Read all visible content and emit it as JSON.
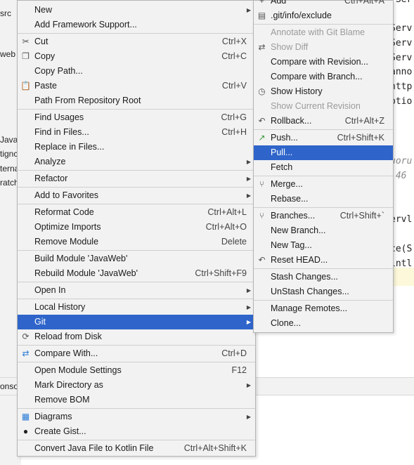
{
  "background": {
    "project_tree": [
      {
        "text": "src"
      },
      {
        "text": "web"
      },
      {
        "text": "Java"
      },
      {
        "text": "tignc"
      },
      {
        "text": "terna"
      },
      {
        "text": "ratch"
      }
    ],
    "editor_lines": [
      {
        "text": ".Ser",
        "italic": false
      },
      {
        "text": "Serv",
        "italic": false
      },
      {
        "text": "Serv",
        "italic": false
      },
      {
        "text": "Serv",
        "italic": false
      },
      {
        "text": "anno",
        "italic": false
      },
      {
        "text": "http",
        "italic": false
      },
      {
        "text": "ptio",
        "italic": false
      },
      {
        "text": "uoru",
        "italic": true
      },
      {
        "text": ":46",
        "italic": true
      },
      {
        "text": "ervl",
        "italic": false
      },
      {
        "text": "ce(S",
        "italic": false
      },
      {
        "text": "intl",
        "italic": false
      }
    ],
    "bottom_tab": "onso"
  },
  "main_menu": {
    "items": [
      {
        "type": "item",
        "label": "New",
        "icon": "",
        "shortcut": "",
        "submenu": true,
        "disabled": false,
        "selected": false
      },
      {
        "type": "item",
        "label": "Add Framework Support...",
        "icon": "",
        "shortcut": "",
        "submenu": false,
        "disabled": false,
        "selected": false
      },
      {
        "type": "sep"
      },
      {
        "type": "item",
        "label": "Cut",
        "icon": "scissors-icon",
        "shortcut": "Ctrl+X",
        "submenu": false,
        "disabled": false,
        "selected": false
      },
      {
        "type": "item",
        "label": "Copy",
        "icon": "copy-icon",
        "shortcut": "Ctrl+C",
        "submenu": false,
        "disabled": false,
        "selected": false
      },
      {
        "type": "item",
        "label": "Copy Path...",
        "icon": "",
        "shortcut": "",
        "submenu": false,
        "disabled": false,
        "selected": false
      },
      {
        "type": "item",
        "label": "Paste",
        "icon": "paste-icon",
        "shortcut": "Ctrl+V",
        "submenu": false,
        "disabled": false,
        "selected": false
      },
      {
        "type": "item",
        "label": "Path From Repository Root",
        "icon": "",
        "shortcut": "",
        "submenu": false,
        "disabled": false,
        "selected": false
      },
      {
        "type": "sep"
      },
      {
        "type": "item",
        "label": "Find Usages",
        "icon": "",
        "shortcut": "Ctrl+G",
        "submenu": false,
        "disabled": false,
        "selected": false
      },
      {
        "type": "item",
        "label": "Find in Files...",
        "icon": "",
        "shortcut": "Ctrl+H",
        "submenu": false,
        "disabled": false,
        "selected": false
      },
      {
        "type": "item",
        "label": "Replace in Files...",
        "icon": "",
        "shortcut": "",
        "submenu": false,
        "disabled": false,
        "selected": false
      },
      {
        "type": "item",
        "label": "Analyze",
        "icon": "",
        "shortcut": "",
        "submenu": true,
        "disabled": false,
        "selected": false
      },
      {
        "type": "sep"
      },
      {
        "type": "item",
        "label": "Refactor",
        "icon": "",
        "shortcut": "",
        "submenu": true,
        "disabled": false,
        "selected": false
      },
      {
        "type": "sep"
      },
      {
        "type": "item",
        "label": "Add to Favorites",
        "icon": "",
        "shortcut": "",
        "submenu": true,
        "disabled": false,
        "selected": false
      },
      {
        "type": "sep"
      },
      {
        "type": "item",
        "label": "Reformat Code",
        "icon": "",
        "shortcut": "Ctrl+Alt+L",
        "submenu": false,
        "disabled": false,
        "selected": false
      },
      {
        "type": "item",
        "label": "Optimize Imports",
        "icon": "",
        "shortcut": "Ctrl+Alt+O",
        "submenu": false,
        "disabled": false,
        "selected": false
      },
      {
        "type": "item",
        "label": "Remove Module",
        "icon": "",
        "shortcut": "Delete",
        "submenu": false,
        "disabled": false,
        "selected": false
      },
      {
        "type": "sep"
      },
      {
        "type": "item",
        "label": "Build Module 'JavaWeb'",
        "icon": "",
        "shortcut": "",
        "submenu": false,
        "disabled": false,
        "selected": false
      },
      {
        "type": "item",
        "label": "Rebuild Module 'JavaWeb'",
        "icon": "",
        "shortcut": "Ctrl+Shift+F9",
        "submenu": false,
        "disabled": false,
        "selected": false
      },
      {
        "type": "sep"
      },
      {
        "type": "item",
        "label": "Open In",
        "icon": "",
        "shortcut": "",
        "submenu": true,
        "disabled": false,
        "selected": false
      },
      {
        "type": "sep"
      },
      {
        "type": "item",
        "label": "Local History",
        "icon": "",
        "shortcut": "",
        "submenu": true,
        "disabled": false,
        "selected": false
      },
      {
        "type": "item",
        "label": "Git",
        "icon": "",
        "shortcut": "",
        "submenu": true,
        "disabled": false,
        "selected": true
      },
      {
        "type": "item",
        "label": "Reload from Disk",
        "icon": "reload-icon",
        "shortcut": "",
        "submenu": false,
        "disabled": false,
        "selected": false
      },
      {
        "type": "sep"
      },
      {
        "type": "item",
        "label": "Compare With...",
        "icon": "compare-icon",
        "shortcut": "Ctrl+D",
        "submenu": false,
        "disabled": false,
        "selected": false
      },
      {
        "type": "sep"
      },
      {
        "type": "item",
        "label": "Open Module Settings",
        "icon": "",
        "shortcut": "F12",
        "submenu": false,
        "disabled": false,
        "selected": false
      },
      {
        "type": "item",
        "label": "Mark Directory as",
        "icon": "",
        "shortcut": "",
        "submenu": true,
        "disabled": false,
        "selected": false
      },
      {
        "type": "item",
        "label": "Remove BOM",
        "icon": "",
        "shortcut": "",
        "submenu": false,
        "disabled": false,
        "selected": false
      },
      {
        "type": "sep"
      },
      {
        "type": "item",
        "label": "Diagrams",
        "icon": "diagram-icon",
        "shortcut": "",
        "submenu": true,
        "disabled": false,
        "selected": false
      },
      {
        "type": "item",
        "label": "Create Gist...",
        "icon": "github-icon",
        "shortcut": "",
        "submenu": false,
        "disabled": false,
        "selected": false
      },
      {
        "type": "sep"
      },
      {
        "type": "item",
        "label": "Convert Java File to Kotlin File",
        "icon": "",
        "shortcut": "Ctrl+Alt+Shift+K",
        "submenu": false,
        "disabled": false,
        "selected": false
      }
    ]
  },
  "git_submenu": {
    "items": [
      {
        "type": "item",
        "label": "Add",
        "icon": "add-icon",
        "shortcut": "Ctrl+Alt+A",
        "disabled": false,
        "selected": false
      },
      {
        "type": "item",
        "label": ".git/info/exclude",
        "icon": "file-icon",
        "shortcut": "",
        "disabled": false,
        "selected": false
      },
      {
        "type": "sep"
      },
      {
        "type": "item",
        "label": "Annotate with Git Blame",
        "icon": "",
        "shortcut": "",
        "disabled": true,
        "selected": false
      },
      {
        "type": "item",
        "label": "Show Diff",
        "icon": "diff-icon",
        "shortcut": "",
        "disabled": true,
        "selected": false
      },
      {
        "type": "item",
        "label": "Compare with Revision...",
        "icon": "",
        "shortcut": "",
        "disabled": false,
        "selected": false
      },
      {
        "type": "item",
        "label": "Compare with Branch...",
        "icon": "",
        "shortcut": "",
        "disabled": false,
        "selected": false
      },
      {
        "type": "item",
        "label": "Show History",
        "icon": "clock-icon",
        "shortcut": "",
        "disabled": false,
        "selected": false
      },
      {
        "type": "item",
        "label": "Show Current Revision",
        "icon": "",
        "shortcut": "",
        "disabled": true,
        "selected": false
      },
      {
        "type": "item",
        "label": "Rollback...",
        "icon": "rollback-icon",
        "shortcut": "Ctrl+Alt+Z",
        "disabled": false,
        "selected": false
      },
      {
        "type": "sep"
      },
      {
        "type": "item",
        "label": "Push...",
        "icon": "push-icon",
        "shortcut": "Ctrl+Shift+K",
        "disabled": false,
        "selected": false
      },
      {
        "type": "item",
        "label": "Pull...",
        "icon": "",
        "shortcut": "",
        "disabled": false,
        "selected": true
      },
      {
        "type": "item",
        "label": "Fetch",
        "icon": "",
        "shortcut": "",
        "disabled": false,
        "selected": false
      },
      {
        "type": "sep"
      },
      {
        "type": "item",
        "label": "Merge...",
        "icon": "merge-icon",
        "shortcut": "",
        "disabled": false,
        "selected": false
      },
      {
        "type": "item",
        "label": "Rebase...",
        "icon": "",
        "shortcut": "",
        "disabled": false,
        "selected": false
      },
      {
        "type": "sep"
      },
      {
        "type": "item",
        "label": "Branches...",
        "icon": "branch-icon",
        "shortcut": "Ctrl+Shift+`",
        "disabled": false,
        "selected": false
      },
      {
        "type": "item",
        "label": "New Branch...",
        "icon": "",
        "shortcut": "",
        "disabled": false,
        "selected": false
      },
      {
        "type": "item",
        "label": "New Tag...",
        "icon": "",
        "shortcut": "",
        "disabled": false,
        "selected": false
      },
      {
        "type": "item",
        "label": "Reset HEAD...",
        "icon": "reset-icon",
        "shortcut": "",
        "disabled": false,
        "selected": false
      },
      {
        "type": "sep"
      },
      {
        "type": "item",
        "label": "Stash Changes...",
        "icon": "",
        "shortcut": "",
        "disabled": false,
        "selected": false
      },
      {
        "type": "item",
        "label": "UnStash Changes...",
        "icon": "",
        "shortcut": "",
        "disabled": false,
        "selected": false
      },
      {
        "type": "sep"
      },
      {
        "type": "item",
        "label": "Manage Remotes...",
        "icon": "",
        "shortcut": "",
        "disabled": false,
        "selected": false
      },
      {
        "type": "item",
        "label": "Clone...",
        "icon": "",
        "shortcut": "",
        "disabled": false,
        "selected": false
      }
    ]
  }
}
